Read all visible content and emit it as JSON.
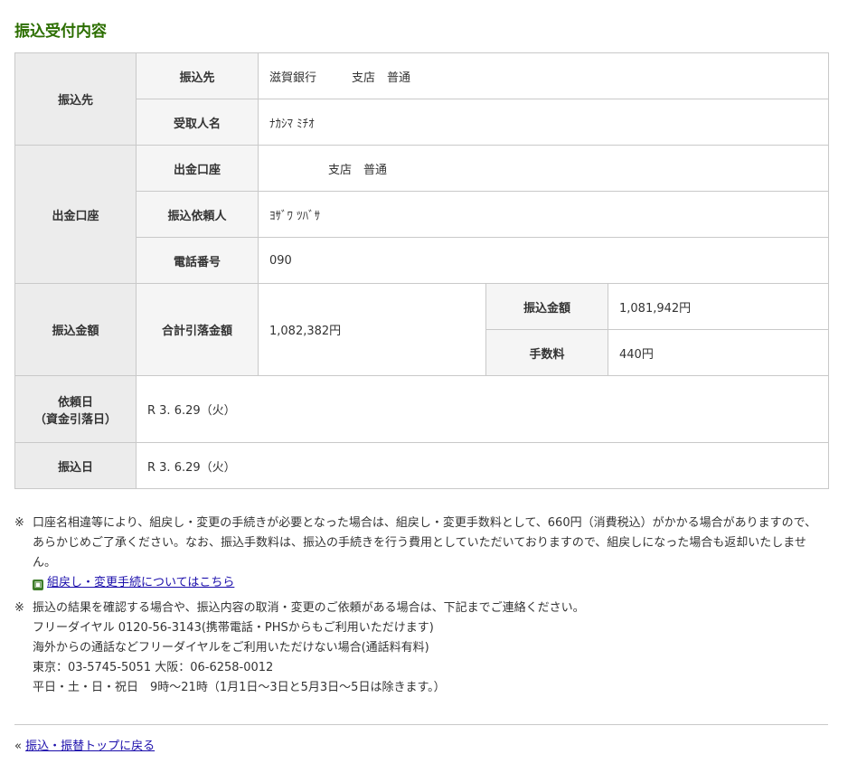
{
  "page_title": "振込受付内容",
  "table": {
    "furikomisaki_group": "振込先",
    "furikomisaki_label": "振込先",
    "furikomisaki_value": "滋賀銀行　　　支店　普通",
    "uketorinin_label": "受取人名",
    "uketorinin_value": "ﾅｶｼﾏ ﾐﾁｵ",
    "shukkin_group": "出金口座",
    "shukkin_label": "出金口座",
    "shukkin_value": "　　　　　支店　普通",
    "irainin_label": "振込依頼人",
    "irainin_value": "ﾖｻﾞﾜ ﾂﾊﾞｻ",
    "phone_label": "電話番号",
    "phone_value": "090",
    "amount_group": "振込金額",
    "total_label": "合計引落金額",
    "total_value": "1,082,382円",
    "transfer_amount_label": "振込金額",
    "transfer_amount_value": "1,081,942円",
    "fee_label": "手数料",
    "fee_value": "440円",
    "request_date_label_1": "依頼日",
    "request_date_label_2": "（資金引落日）",
    "request_date_value": "R 3. 6.29（火）",
    "transfer_date_label": "振込日",
    "transfer_date_value": "R 3. 6.29（火）"
  },
  "notes": {
    "mark": "※",
    "note1": "口座名相違等により、組戻し・変更の手続きが必要となった場合は、組戻し・変更手数料として、660円（消費税込）がかかる場合がありますので、あらかじめご了承ください。なお、振込手数料は、振込の手続きを行う費用としていただいておりますので、組戻しになった場合も返却いたしません。",
    "note1_link": "組戻し・変更手続についてはこちら",
    "note2_line1": "振込の結果を確認する場合や、振込内容の取消・変更のご依頼がある場合は、下記までご連絡ください。",
    "note2_line2": "フリーダイヤル 0120-56-3143(携帯電話・PHSからもご利用いただけます)",
    "note2_line3": "海外からの通話などフリーダイヤルをご利用いただけない場合(通話料有料)",
    "note2_line4": "東京：03-5745-5051 大阪：06-6258-0012",
    "note2_line5": "平日・土・日・祝日　9時～21時（1月1日～3日と5月3日～5日は除きます。）"
  },
  "footer": {
    "back_prefix": "«",
    "back_link": "振込・振替トップに戻る"
  },
  "icons": {
    "external_link_icon": "window-icon"
  },
  "colors": {
    "title": "#2c6e00",
    "header_bg": "#ececec",
    "border": "#c9c9c9",
    "link": "#1a0dab"
  }
}
